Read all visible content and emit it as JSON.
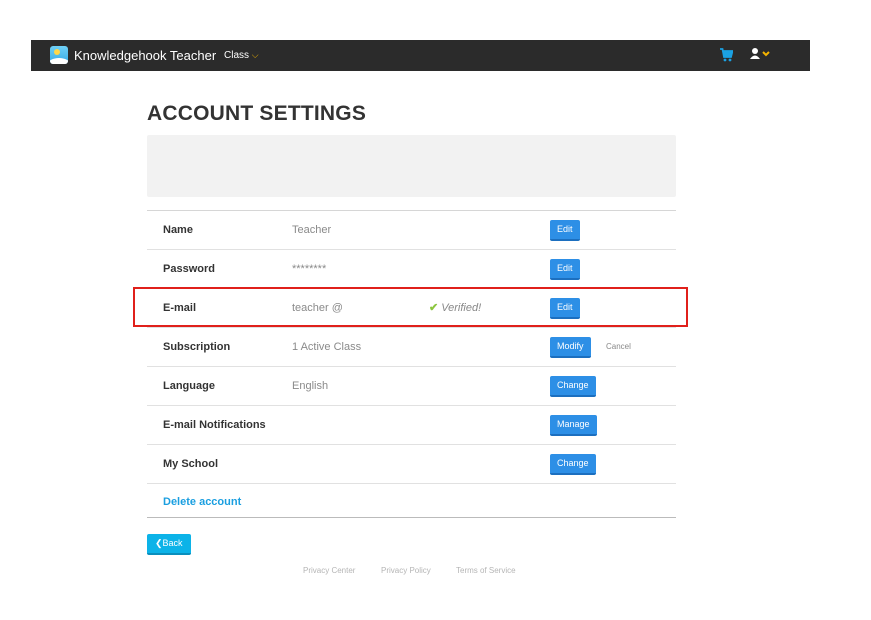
{
  "navbar": {
    "app_title": "Knowledgehook Teacher",
    "class_menu_label": "Class",
    "background_color": "#2b2b2b",
    "cart_icon_color": "#1ba1e2",
    "chevron_color": "#f4b400"
  },
  "page": {
    "title": "ACCOUNT SETTINGS"
  },
  "settings": {
    "rows": [
      {
        "label": "Name",
        "value": "Teacher",
        "button": "Edit"
      },
      {
        "label": "Password",
        "value": "********",
        "button": "Edit"
      },
      {
        "label": "E-mail",
        "value": "teacher @",
        "status": "Verified!",
        "button": "Edit"
      },
      {
        "label": "Subscription",
        "value": "1 Active Class",
        "button": "Modify",
        "secondary_link": "Cancel"
      },
      {
        "label": "Language",
        "value": "English",
        "button": "Change"
      },
      {
        "label": "E-mail Notifications",
        "value": "",
        "button": "Manage"
      },
      {
        "label": "My School",
        "value": "",
        "button": "Change"
      }
    ],
    "delete_account_label": "Delete account",
    "button_color": "#2d8fe6",
    "verified_check_color": "#8cc63f",
    "highlight_color": "#e0201b"
  },
  "back_button_label": "Back",
  "footer": {
    "links": [
      "Privacy Center",
      "Privacy Policy",
      "Terms of Service"
    ]
  }
}
